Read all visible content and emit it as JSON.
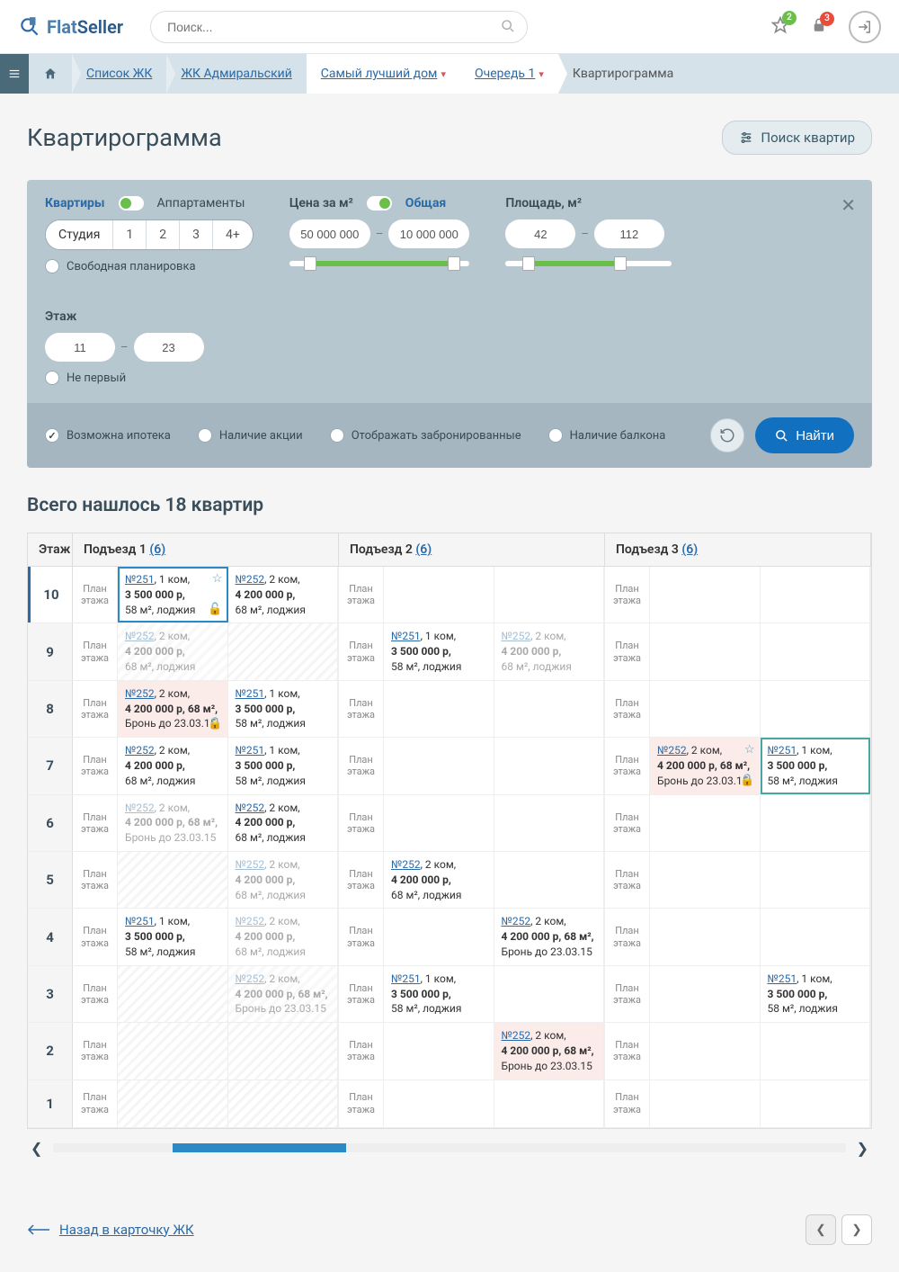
{
  "brand": {
    "part1": "Flat",
    "part2": "Seller"
  },
  "search": {
    "placeholder": "Поиск..."
  },
  "header_badges": {
    "fav": "2",
    "lock": "3"
  },
  "breadcrumbs": {
    "list_jk": "Список ЖК",
    "jk_name": "ЖК Адмиральский",
    "house": "Самый лучший дом",
    "queue": "Очередь 1",
    "current": "Квартирограмма"
  },
  "page_title": "Квартирограмма",
  "filter_toggle": "Поиск квартир",
  "filters": {
    "type_tab1": "Квартиры",
    "type_tab2": "Аппартаменты",
    "rooms": [
      "Студия",
      "1",
      "2",
      "3",
      "4+"
    ],
    "free_plan": "Свободная планировка",
    "price_label": "Цена за м²",
    "price_total": "Общая",
    "price_from": "50 000 000",
    "price_to": "10 000 000",
    "area_label": "Площадь, м²",
    "area_from": "42",
    "area_to": "112",
    "floor_label": "Этаж",
    "floor_from": "11",
    "floor_to": "23",
    "not_first": "Не первый",
    "mortgage": "Возможна ипотека",
    "promo": "Наличие акции",
    "show_reserved": "Отображать забронированные",
    "balcony": "Наличие балкона",
    "find_button": "Найти"
  },
  "results_count": "Всего нашлось 18 квартир",
  "grid": {
    "floor_head": "Этаж",
    "sections": [
      {
        "title": "Подъезд 1",
        "count": "(6)"
      },
      {
        "title": "Подъезд 2",
        "count": "(6)"
      },
      {
        "title": "Подъезд 3",
        "count": "(6)"
      }
    ],
    "plan_label": "План\nэтажа",
    "floors": [
      10,
      9,
      8,
      7,
      6,
      5,
      4,
      3,
      2,
      1
    ],
    "flat_251_1k": {
      "num": "№251",
      "rooms": ", 1 ком,",
      "price": "3 500 000 р,",
      "area": "58 м², лоджия"
    },
    "flat_252_2k": {
      "num": "№252",
      "rooms": ", 2 ком,",
      "price": "4 200 000 р,",
      "area": "68 м², лоджия"
    },
    "flat_252_2k_res": {
      "num": "№252",
      "rooms": ", 2 ком,",
      "price": "4 200 000 р, 68 м²,",
      "reserve": "Бронь до 23.03.15"
    }
  },
  "back_link": "Назад в карточку ЖК"
}
